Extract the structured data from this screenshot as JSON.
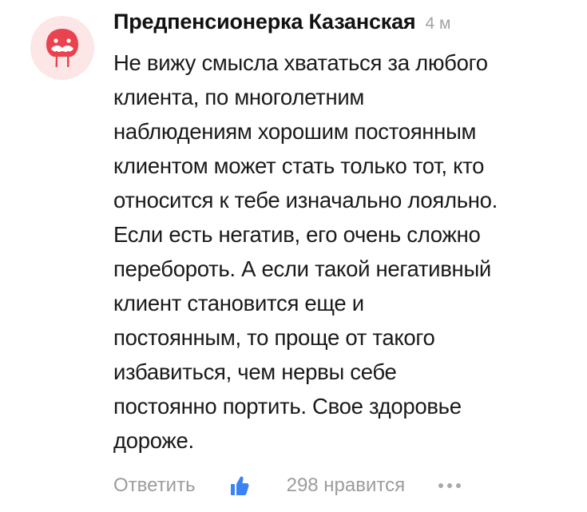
{
  "comment": {
    "author": "Предпенсионерка Казанская",
    "time": "4 м",
    "avatar_icon": "walrus-icon",
    "avatar_color": "#e8434f",
    "avatar_bg": "#fce6e6",
    "text_lines": [
      "Не вижу смысла хвататься за любого",
      "клиента, по многолетним",
      "наблюдениям хорошим постоянным",
      "клиентом может стать только тот, кто",
      "относится к тебе изначально лояльно.",
      "Если есть негатив, его очень сложно",
      "перебороть. А если такой негативный",
      "клиент становится еще и",
      "постоянным, то проще от такого",
      "избавиться, чем нервы себе",
      "постоянно портить. Свое здоровье",
      "дороже."
    ],
    "reply_label": "Ответить",
    "like_icon": "thumbs-up-icon",
    "like_color": "#3b82f6",
    "likes_text": "298 нравится",
    "more_icon": "more-dots-icon"
  }
}
